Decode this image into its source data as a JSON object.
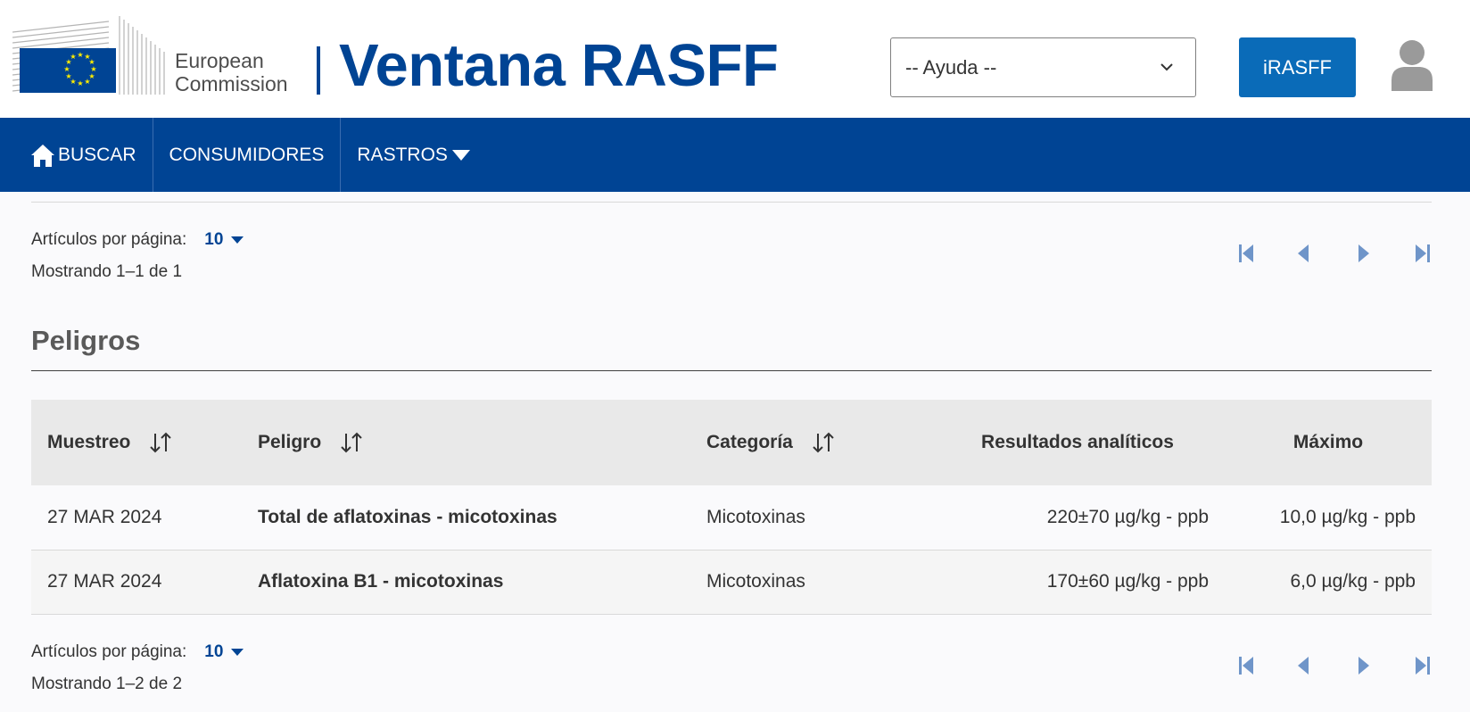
{
  "header": {
    "logo_line1": "European",
    "logo_line2": "Commission",
    "site_title": "Ventana RASFF",
    "help_select_value": "-- Ayuda --",
    "irasff_label": "iRASFF"
  },
  "nav": {
    "items": [
      {
        "label": "BUSCAR",
        "icon": "home-icon"
      },
      {
        "label": "CONSUMIDORES"
      },
      {
        "label": "RASTROS",
        "icon": "caret-down-icon"
      }
    ]
  },
  "pager_top": {
    "per_page_label": "Artículos por página:",
    "per_page_value": "10",
    "showing": "Mostrando 1–1 de 1"
  },
  "hazards": {
    "title": "Peligros",
    "columns": [
      "Muestreo",
      "Peligro",
      "Categoría",
      "Resultados analíticos",
      "Máximo"
    ],
    "rows": [
      {
        "date": "27 MAR 2024",
        "hazard": "Total de aflatoxinas - micotoxinas",
        "category": "Micotoxinas",
        "result": "220±70 µg/kg - ppb",
        "max": "10,0 µg/kg - ppb"
      },
      {
        "date": "27 MAR 2024",
        "hazard": "Aflatoxina B1 - micotoxinas",
        "category": "Micotoxinas",
        "result": "170±60 µg/kg - ppb",
        "max": "6,0 µg/kg - ppb"
      }
    ]
  },
  "pager_bottom": {
    "per_page_label": "Artículos por página:",
    "per_page_value": "10",
    "showing": "Mostrando 1–2 de 2"
  },
  "colors": {
    "brand_blue": "#004494",
    "button_blue": "#0a6bb8",
    "eu_yellow": "#ffed00"
  }
}
